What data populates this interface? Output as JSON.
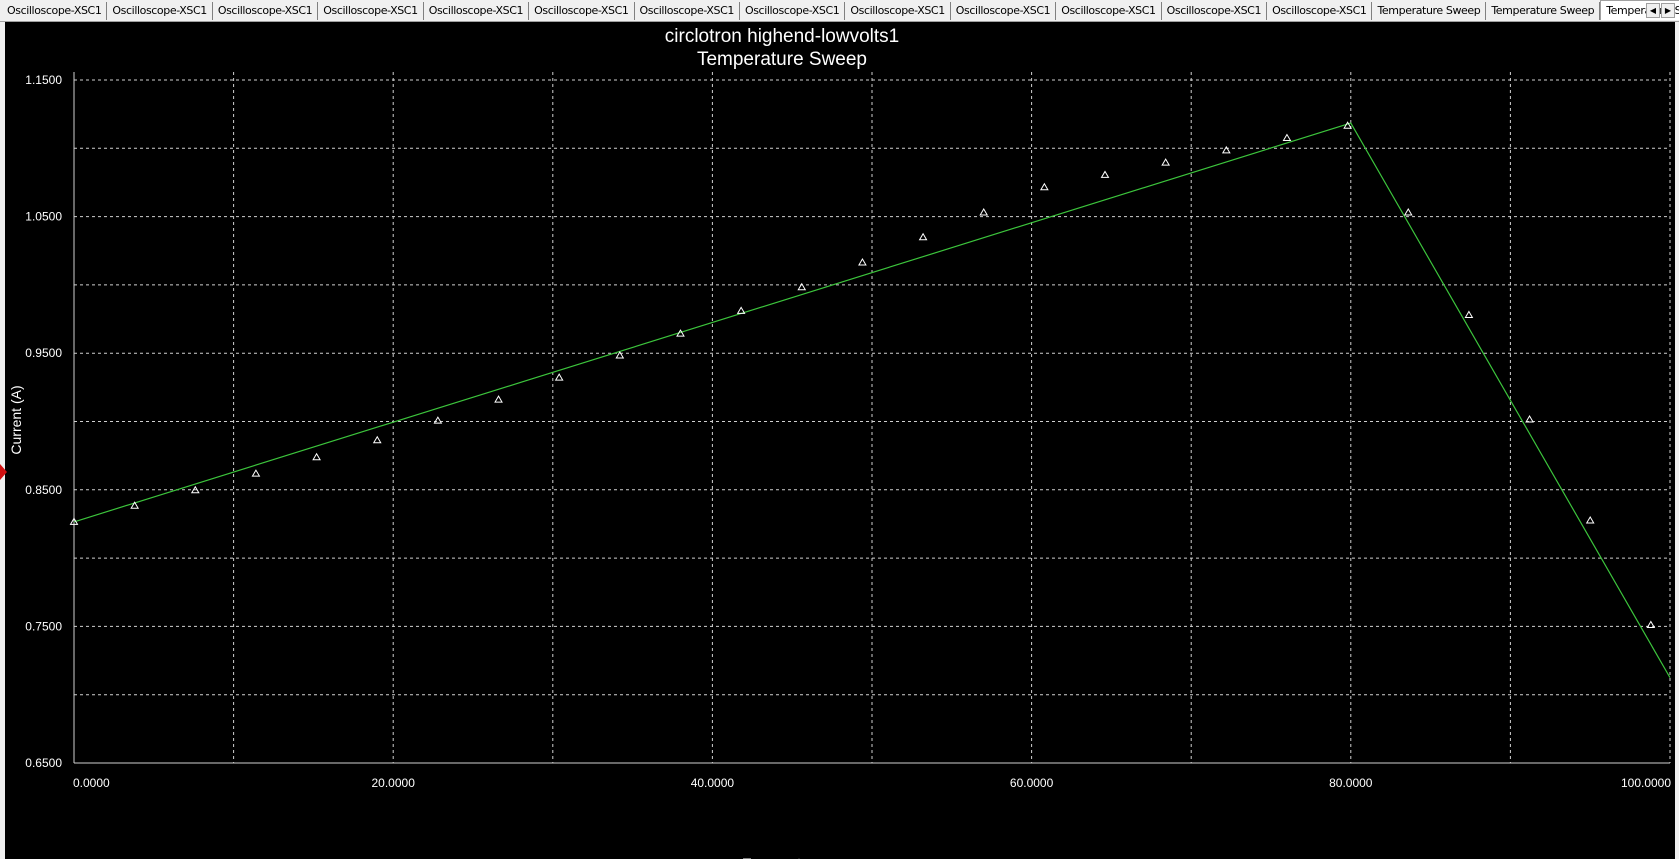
{
  "tabs": [
    {
      "label": "Oscilloscope-XSC1",
      "active": false
    },
    {
      "label": "Oscilloscope-XSC1",
      "active": false
    },
    {
      "label": "Oscilloscope-XSC1",
      "active": false
    },
    {
      "label": "Oscilloscope-XSC1",
      "active": false
    },
    {
      "label": "Oscilloscope-XSC1",
      "active": false
    },
    {
      "label": "Oscilloscope-XSC1",
      "active": false
    },
    {
      "label": "Oscilloscope-XSC1",
      "active": false
    },
    {
      "label": "Oscilloscope-XSC1",
      "active": false
    },
    {
      "label": "Oscilloscope-XSC1",
      "active": false
    },
    {
      "label": "Oscilloscope-XSC1",
      "active": false
    },
    {
      "label": "Oscilloscope-XSC1",
      "active": false
    },
    {
      "label": "Oscilloscope-XSC1",
      "active": false
    },
    {
      "label": "Oscilloscope-XSC1",
      "active": false
    },
    {
      "label": "Temperature Sweep",
      "active": false
    },
    {
      "label": "Temperature Sweep",
      "active": false
    },
    {
      "label": "Temperature Sweep",
      "active": true
    }
  ],
  "scroll_icons": {
    "left": "arrow-left-icon",
    "right": "arrow-right-icon"
  },
  "colors": {
    "background": "#000000",
    "trace": "#3cc43c",
    "grid": "#d0d0d0",
    "text": "#ffffff",
    "marker": "#d01010"
  },
  "chart_data": {
    "type": "line",
    "title": "circlotron highend-lowvolts1",
    "subtitle": "Temperature Sweep",
    "xlabel": "Temperature",
    "ylabel": "Current (A)",
    "xlim": [
      0,
      100
    ],
    "ylim": [
      0.65,
      1.15
    ],
    "x_ticks": [
      0,
      20,
      40,
      60,
      80,
      100
    ],
    "x_tick_labels": [
      "0.0000",
      "20.0000",
      "40.0000",
      "60.0000",
      "80.0000",
      "100.0000"
    ],
    "y_ticks": [
      0.65,
      0.75,
      0.85,
      0.95,
      1.05,
      1.15
    ],
    "y_tick_labels": [
      "0.6500",
      "0.7500",
      "0.8500",
      "0.9500",
      "1.0500",
      "1.1500"
    ],
    "minor_x_grid": [
      10,
      30,
      50,
      70,
      90
    ],
    "minor_y_grid": [
      0.7,
      0.8,
      0.9,
      1.0,
      1.1
    ],
    "grid": true,
    "line": {
      "x": [
        0,
        80,
        100
      ],
      "y": [
        0.8265,
        1.1185,
        0.7125
      ]
    },
    "markers": {
      "x": [
        0,
        3.8,
        7.6,
        11.4,
        15.2,
        19.0,
        22.8,
        26.6,
        30.4,
        34.2,
        38.0,
        41.8,
        45.6,
        49.4,
        53.2,
        57.0,
        60.8,
        64.6,
        68.4,
        72.2,
        76.0,
        79.8,
        83.6,
        87.4,
        91.2,
        95.0,
        98.8
      ],
      "y": [
        0.8265,
        0.8383,
        0.8497,
        0.8618,
        0.8738,
        0.8863,
        0.9006,
        0.916,
        0.9321,
        0.9483,
        0.9643,
        0.981,
        0.9983,
        1.0164,
        1.0349,
        1.053,
        1.0715,
        1.0805,
        1.0895,
        1.0985,
        1.1075,
        1.1165,
        1.053,
        0.978,
        0.9015,
        0.8275,
        0.751
      ]
    }
  }
}
